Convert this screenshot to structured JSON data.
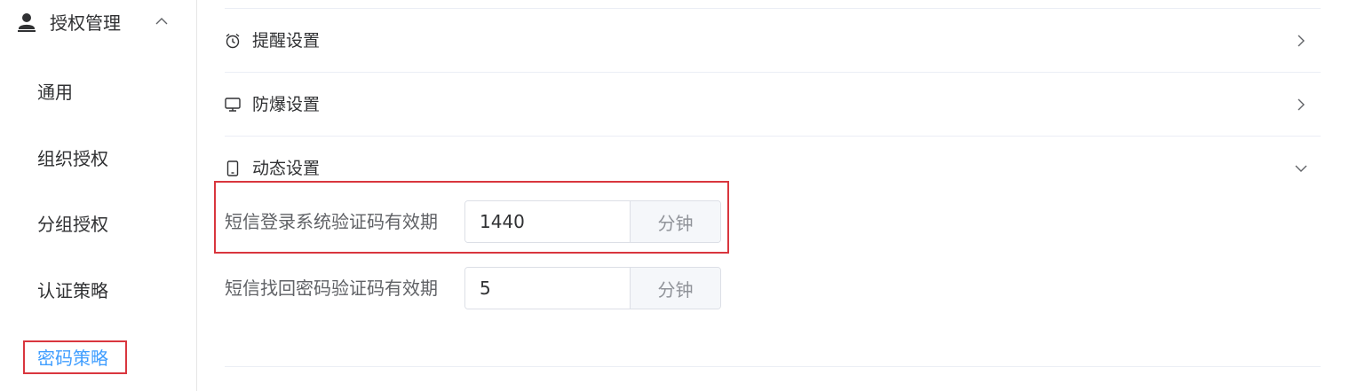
{
  "sidebar": {
    "group": {
      "label": "授权管理",
      "icon": "user-icon",
      "expanded": true
    },
    "items": [
      {
        "label": "通用"
      },
      {
        "label": "组织授权"
      },
      {
        "label": "分组授权"
      },
      {
        "label": "认证策略"
      },
      {
        "label": "密码策略",
        "active": true
      }
    ]
  },
  "panels": [
    {
      "label": "提醒设置",
      "icon": "alarm-clock-icon",
      "expanded": false
    },
    {
      "label": "防爆设置",
      "icon": "monitor-icon",
      "expanded": false
    },
    {
      "label": "动态设置",
      "icon": "mobile-phone-icon",
      "expanded": true
    }
  ],
  "dynamic_settings": {
    "fields": [
      {
        "label": "短信登录系统验证码有效期",
        "value": "1440",
        "unit": "分钟"
      },
      {
        "label": "短信找回密码验证码有效期",
        "value": "5",
        "unit": "分钟"
      }
    ]
  },
  "colors": {
    "accent": "#409eff",
    "annotation": "#d9363e",
    "divider": "#ebeef5"
  }
}
